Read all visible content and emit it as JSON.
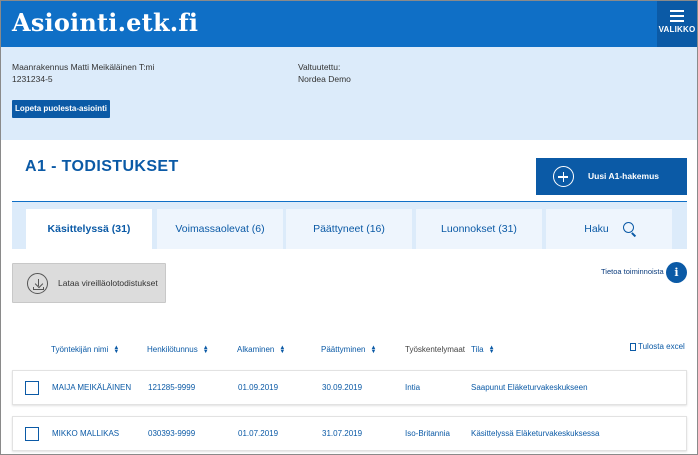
{
  "header": {
    "logo": "Asiointi.etk.fi",
    "menu_label": "VALIKKO"
  },
  "info": {
    "company_name": "Maanrakennus Matti Meikäläinen T:mi",
    "company_id": "1231234-5",
    "authorized_label": "Valtuutettu:",
    "authorized_value": "Nordea Demo",
    "stop_button": "Lopeta puolesta-asiointi"
  },
  "page": {
    "title": "A1 - TODISTUKSET",
    "new_button": "Uusi A1-hakemus"
  },
  "tabs": [
    {
      "label": "Käsittelyssä (31)",
      "active": true
    },
    {
      "label": "Voimassaolevat (6)",
      "active": false
    },
    {
      "label": "Päättyneet (16)",
      "active": false
    },
    {
      "label": "Luonnokset (31)",
      "active": false
    },
    {
      "label": "Haku",
      "active": false
    }
  ],
  "actions": {
    "download_button": "Lataa vireilläolotodistukset",
    "info_link": "Tietoa toiminnoista",
    "print_link": "Tulosta excel"
  },
  "table": {
    "columns": [
      "Työntekijän nimi",
      "Henkilötunnus",
      "Alkaminen",
      "Päättyminen",
      "Työskentelymaat",
      "Tila"
    ],
    "rows": [
      [
        "MAIJA MEIKÄLÄINEN",
        "121285-9999",
        "01.09.2019",
        "30.09.2019",
        "Intia",
        "Saapunut Eläketurvakeskukseen"
      ],
      [
        "MIKKO MALLIKAS",
        "030393-9999",
        "01.07.2019",
        "31.07.2019",
        "Iso-Britannia",
        "Käsittelyssä Eläketurvakeskuksessa"
      ]
    ]
  },
  "colors": {
    "brand_blue": "#0f6fc6",
    "dark_blue": "#0b5aa6",
    "light_band": "#dcebfa"
  }
}
